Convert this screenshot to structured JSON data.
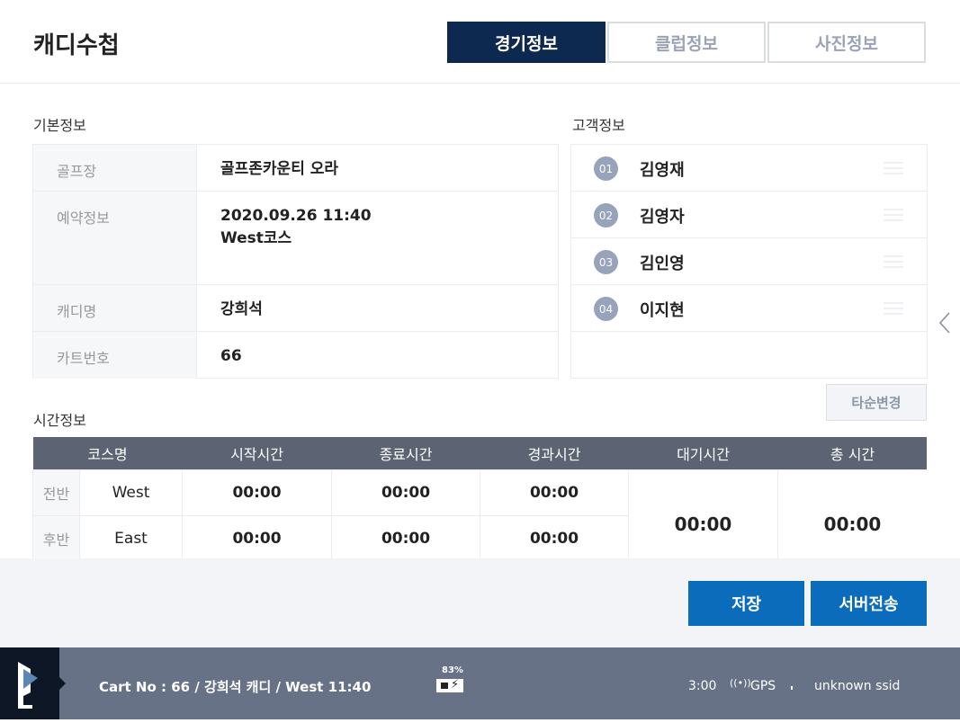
{
  "header": {
    "title": "캐디수첩",
    "tabs": [
      {
        "label": "경기정보",
        "active": true
      },
      {
        "label": "클럽정보"
      },
      {
        "label": "사진정보"
      }
    ]
  },
  "basic": {
    "title": "기본정보",
    "rows": [
      {
        "label": "골프장",
        "value": "골프존카운티 오라"
      },
      {
        "label": "예약정보",
        "value": "2020.09.26 11:40",
        "value2": "West코스"
      },
      {
        "label": "캐디명",
        "value": "강희석"
      },
      {
        "label": "카트번호",
        "value": "66"
      }
    ]
  },
  "customers": {
    "title": "고객정보",
    "items": [
      {
        "num": "01",
        "name": "김영재"
      },
      {
        "num": "02",
        "name": "김영자"
      },
      {
        "num": "03",
        "name": "김인영"
      },
      {
        "num": "04",
        "name": "이지현"
      }
    ],
    "reorder_label": "타순변경"
  },
  "time": {
    "title": "시간정보",
    "headers": [
      "코스명",
      "시작시간",
      "종료시간",
      "경과시간",
      "대기시간",
      "총 시간"
    ],
    "rows": [
      {
        "half": "전반",
        "course": "West",
        "start": "00:00",
        "end": "00:00",
        "elapsed": "00:00"
      },
      {
        "half": "후반",
        "course": "East",
        "start": "00:00",
        "end": "00:00",
        "elapsed": "00:00"
      }
    ],
    "wait": "00:00",
    "total": "00:00"
  },
  "actions": {
    "save": "저장",
    "send": "서버전송"
  },
  "footer": {
    "info": "Cart No : 66 / 강희석 캐디 / West 11:40",
    "battery": "83%",
    "time": "3:00",
    "gps": "GPS",
    "ssid": "unknown ssid"
  },
  "colors": {
    "primary": "#0d2950",
    "button": "#0a6cba",
    "footer": "#677287"
  }
}
